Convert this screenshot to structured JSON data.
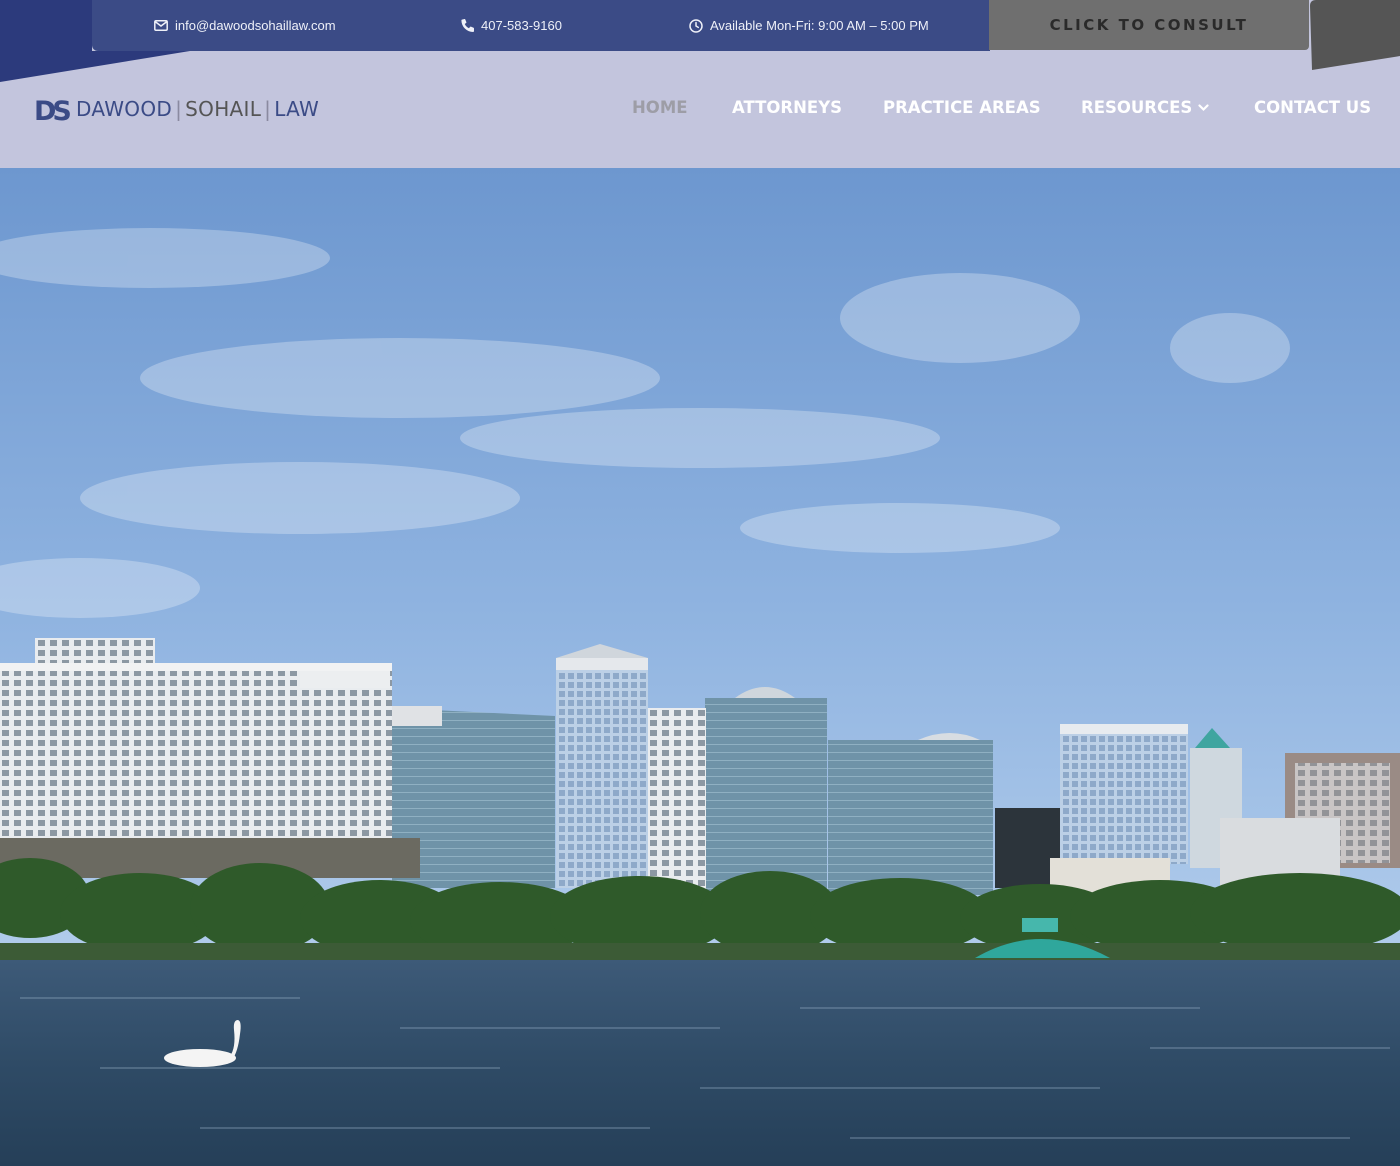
{
  "topbar": {
    "email": "info@dawoodsohaillaw.com",
    "phone": "407-583-9160",
    "hours": "Available Mon-Fri: 9:00 AM – 5:00 PM",
    "cta_label": "CLICK TO CONSULT",
    "icons": {
      "email": "envelope-icon",
      "phone": "phone-icon",
      "hours": "clock-icon"
    }
  },
  "logo": {
    "mark": "DS",
    "part1": "DAWOOD",
    "part2": "SOHAIL",
    "part3": "LAW"
  },
  "nav": {
    "items": [
      {
        "label": "HOME",
        "active": true
      },
      {
        "label": "ATTORNEYS",
        "active": false
      },
      {
        "label": "PRACTICE AREAS",
        "active": false
      },
      {
        "label": "RESOURCES",
        "active": false,
        "has_dropdown": true
      },
      {
        "label": "CONTACT US",
        "active": false
      }
    ]
  },
  "colors": {
    "brand_navy": "#3b4b86",
    "header_bg": "#c3c5dd",
    "cta_bg": "#6f6f6f",
    "nav_active": "#9d9da6",
    "nav_text": "#ffffff"
  }
}
